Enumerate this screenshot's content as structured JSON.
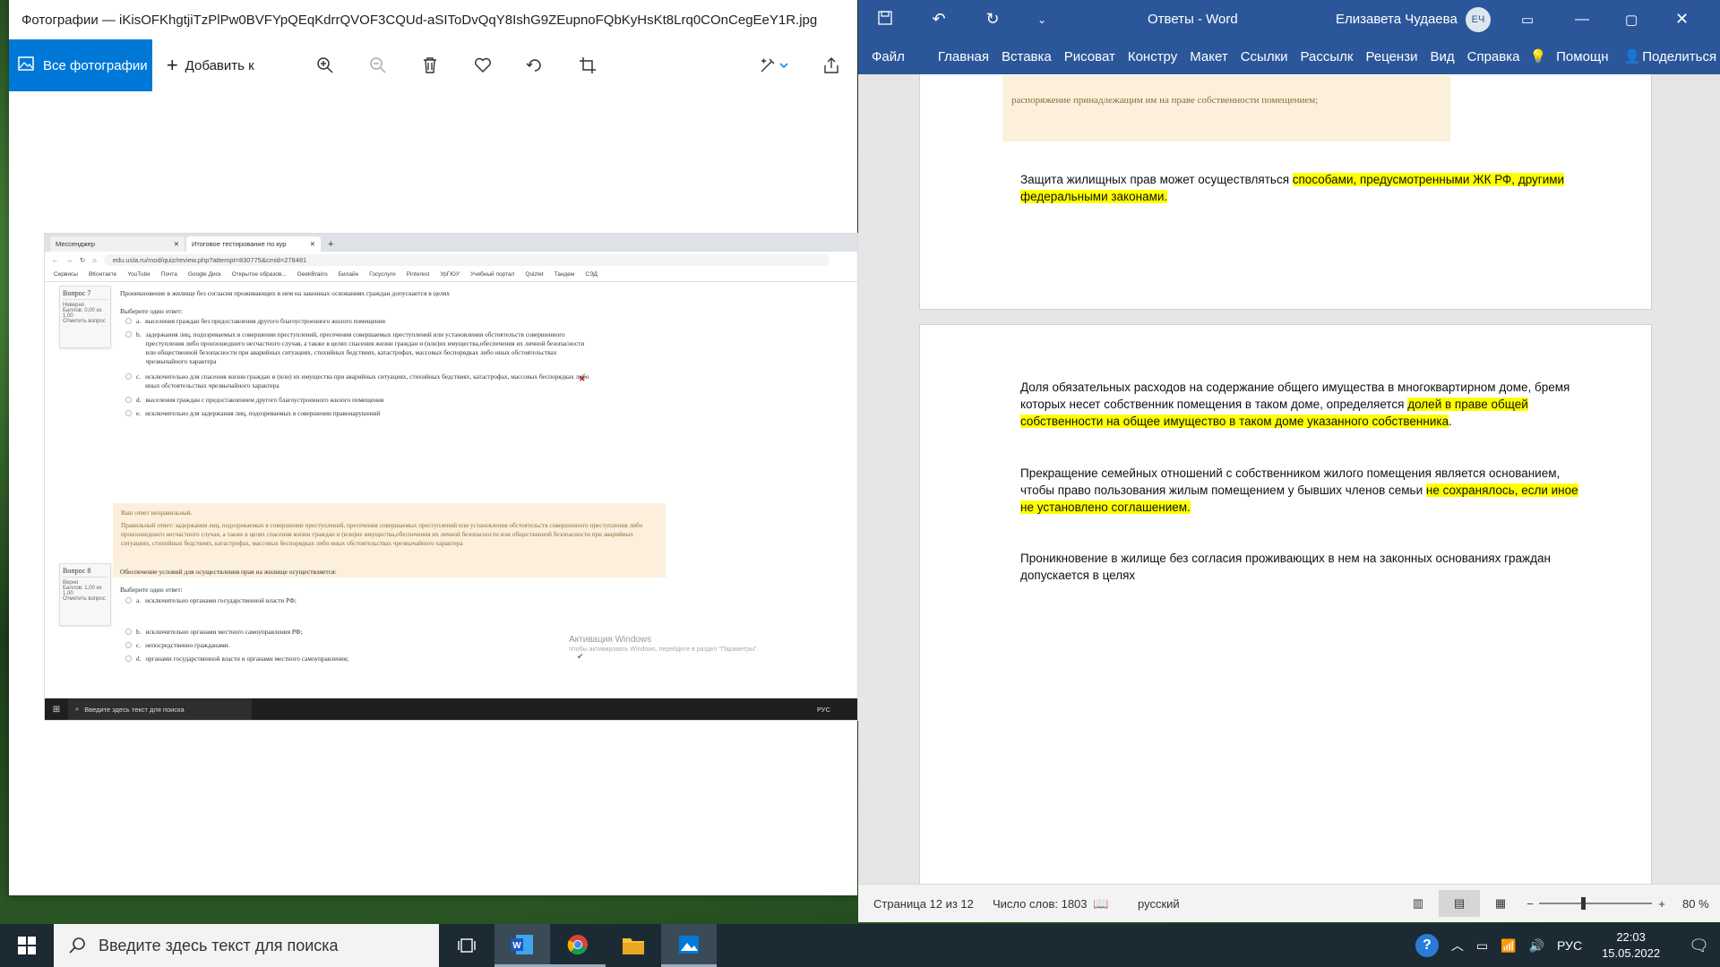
{
  "photos": {
    "title": "Фотографии — iKisOFKhgtjiTzPlPw0BVFYpQEqKdrrQVOF3CQUd-aSIToDvQqY8IshG9ZEupnoFQbKyHsKt8Lrq0COnCegEeY1R.jpg",
    "all_photos": "Все фотографии",
    "add": "Добавить к",
    "icons": [
      "zoom-in-icon",
      "zoom-out-icon",
      "delete-icon",
      "heart-icon",
      "rotate-icon",
      "crop-icon",
      "edit-icon",
      "share-icon"
    ]
  },
  "shot": {
    "tabs": [
      "Мессенджер",
      "Итоговое тестирование по кур"
    ],
    "url": "edu.usla.ru/mod/quiz/review.php?attempt=830775&cmid=278481",
    "bookmarks": [
      "Сервисы",
      "ВКонтакте",
      "YouTube",
      "Почта",
      "Google Диск",
      "Открытое образов...",
      "GeekBrains",
      "Билайн",
      "Госуслуги",
      "Pinterest",
      "УрГЮУ",
      "Учебный портал",
      "Quizlet",
      "Тандем",
      "СЭД"
    ],
    "q7": {
      "label": "Вопрос 7",
      "status": "Неверно",
      "score": "Баллов: 0,00 из 1,00",
      "flag": "Отметить вопрос",
      "text": "Проникновение в жилище без согласия проживающих в нем на законных основаниях граждан допускается в целях",
      "prompt": "Выберите один ответ:",
      "options": [
        {
          "k": "a.",
          "t": "выселения граждан без предоставления другого благоустроенного жилого помещения"
        },
        {
          "k": "b.",
          "t": "задержания лиц, подозреваемых в совершении преступлений, пресечения совершаемых преступлений или установления обстоятельств совершенного преступления либо произошедшего несчастного случая, а также в целях спасения жизни граждан и (или)их имущества,обеспечения их личной безопасности или общественной безопасности при аварийных ситуациях,  стихийных бедствиях, катастрофах, массовых беспорядках либо иных обстоятельствах чрезвычайного характера"
        },
        {
          "k": "c.",
          "t": "исключительно для спасения жизни граждан и (или) их имущества при аварийных ситуациях, стихийных бедствиях, катастрофах, массовых беспорядках либо иных обстоятельствах чрезвычайного характера"
        },
        {
          "k": "d.",
          "t": "выселения граждан с предоставлением другого благоустроенного жилого помещения"
        },
        {
          "k": "e.",
          "t": "исключительно для задержания лиц, подозреваемых в совершении правонарушений"
        }
      ],
      "feedback_title": "Ваш ответ неправильный.",
      "feedback": "Правильный ответ: задержания лиц, подозреваемых в совершении преступлений, пресечения совершаемых преступлений или установления обстоятельств совершенного преступления либо произошедшего несчастного случая, а также в целях спасения жизни граждан и (или)их имущества,обеспечения их личной безопасности или общественной безопасности при аварийных ситуациях,  стихийных бедствиях, катастрофах, массовых беспорядках либо иных обстоятельствах чрезвычайного характера"
    },
    "q8": {
      "label": "Вопрос 8",
      "status": "Верно",
      "score": "Баллов: 1,00 из 1,00",
      "flag": "Отметить вопрос",
      "text": "Обеспечение условий для осуществления прав на жилище осуществляется:",
      "prompt": "Выберите один ответ:",
      "options": [
        {
          "k": "a.",
          "t": "исключительно органами государственной власти РФ;"
        },
        {
          "k": "b.",
          "t": "исключительно органами местного самоуправления РФ;"
        },
        {
          "k": "c.",
          "t": "непосредственно гражданами."
        },
        {
          "k": "d.",
          "t": "органами государственной власти и органами местного самоуправления;"
        }
      ]
    },
    "activation_title": "Активация Windows",
    "activation_sub": "Чтобы активировать Windows, перейдите в раздел \"Параметры\".",
    "taskbar_search": "Введите здесь текст для поиска",
    "taskbar_lang": "РУС"
  },
  "word": {
    "title": "Ответы  -  Word",
    "user": "Елизавета Чудаева",
    "initials": "ЕЧ",
    "tabs": [
      "Файл",
      "Главная",
      "Вставка",
      "Рисоват",
      "Констру",
      "Макет",
      "Ссылки",
      "Рассылк",
      "Рецензи",
      "Вид",
      "Справка"
    ],
    "help": "Помощн",
    "share": "Поделиться",
    "page1_top": "распоряжение принадлежащим им на праве собственности помещением;",
    "para1_a": "Защита жилищных прав может осуществляться ",
    "para1_hl": "способами, предусмотренными ЖК РФ, другими федеральными законами.",
    "para2_a": "Доля обязательных расходов на содержание общего имущества в многоквартирном доме, бремя которых несет собственник помещения в таком доме, определяется ",
    "para2_hl": "долей в праве общей собственности на общее имущество в таком доме указанного собственника",
    "para2_b": ".",
    "para3_a": "Прекращение семейных отношений с собственником жилого помещения является основанием, чтобы право пользования жилым помещением у бывших членов семьи ",
    "para3_hl": "не сохранялось, если иное не установлено соглашением.",
    "para4": "Проникновение в жилище без согласия проживающих в нем на законных основаниях граждан допускается в целях",
    "status_page": "Страница 12 из 12",
    "status_words": "Число слов: 1803",
    "status_lang": "русский",
    "zoom": "80 %"
  },
  "taskbar": {
    "search": "Введите здесь текст для поиска",
    "lang": "РУС",
    "time": "22:03",
    "date": "15.05.2022"
  }
}
